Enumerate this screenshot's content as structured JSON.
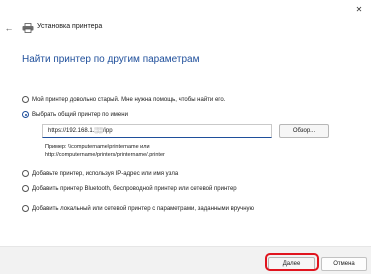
{
  "dialog": {
    "title": "Установка принтера",
    "heading": "Найти принтер по другим параметрам"
  },
  "options": [
    {
      "label": "Мой принтер довольно старый. Мне нужна помощь, чтобы найти его.",
      "checked": false
    },
    {
      "label": "Выбрать общий принтер по имени",
      "checked": true
    },
    {
      "label": "Добавьте принтер, используя IP-адрес или имя узла",
      "checked": false
    },
    {
      "label": "Добавить принтер Bluetooth, беспроводной принтер или сетевой принтер",
      "checked": false
    },
    {
      "label": "Добавить локальный или сетевой принтер с параметрами, заданными вручную",
      "checked": false
    }
  ],
  "share": {
    "value": "https://192.168.1.░░/ipp",
    "browse_label": "Обзор...",
    "example_line1": "Пример: \\\\computername\\printername или",
    "example_line2": "http://computername/printers/printername/.printer"
  },
  "footer": {
    "next_label": "Далее",
    "cancel_label": "Отмена"
  },
  "icons": {
    "close": "close-icon",
    "back": "back-arrow-icon",
    "title": "printer-icon"
  },
  "colors": {
    "accent": "#1f4f9b",
    "highlight": "#e0141e"
  }
}
